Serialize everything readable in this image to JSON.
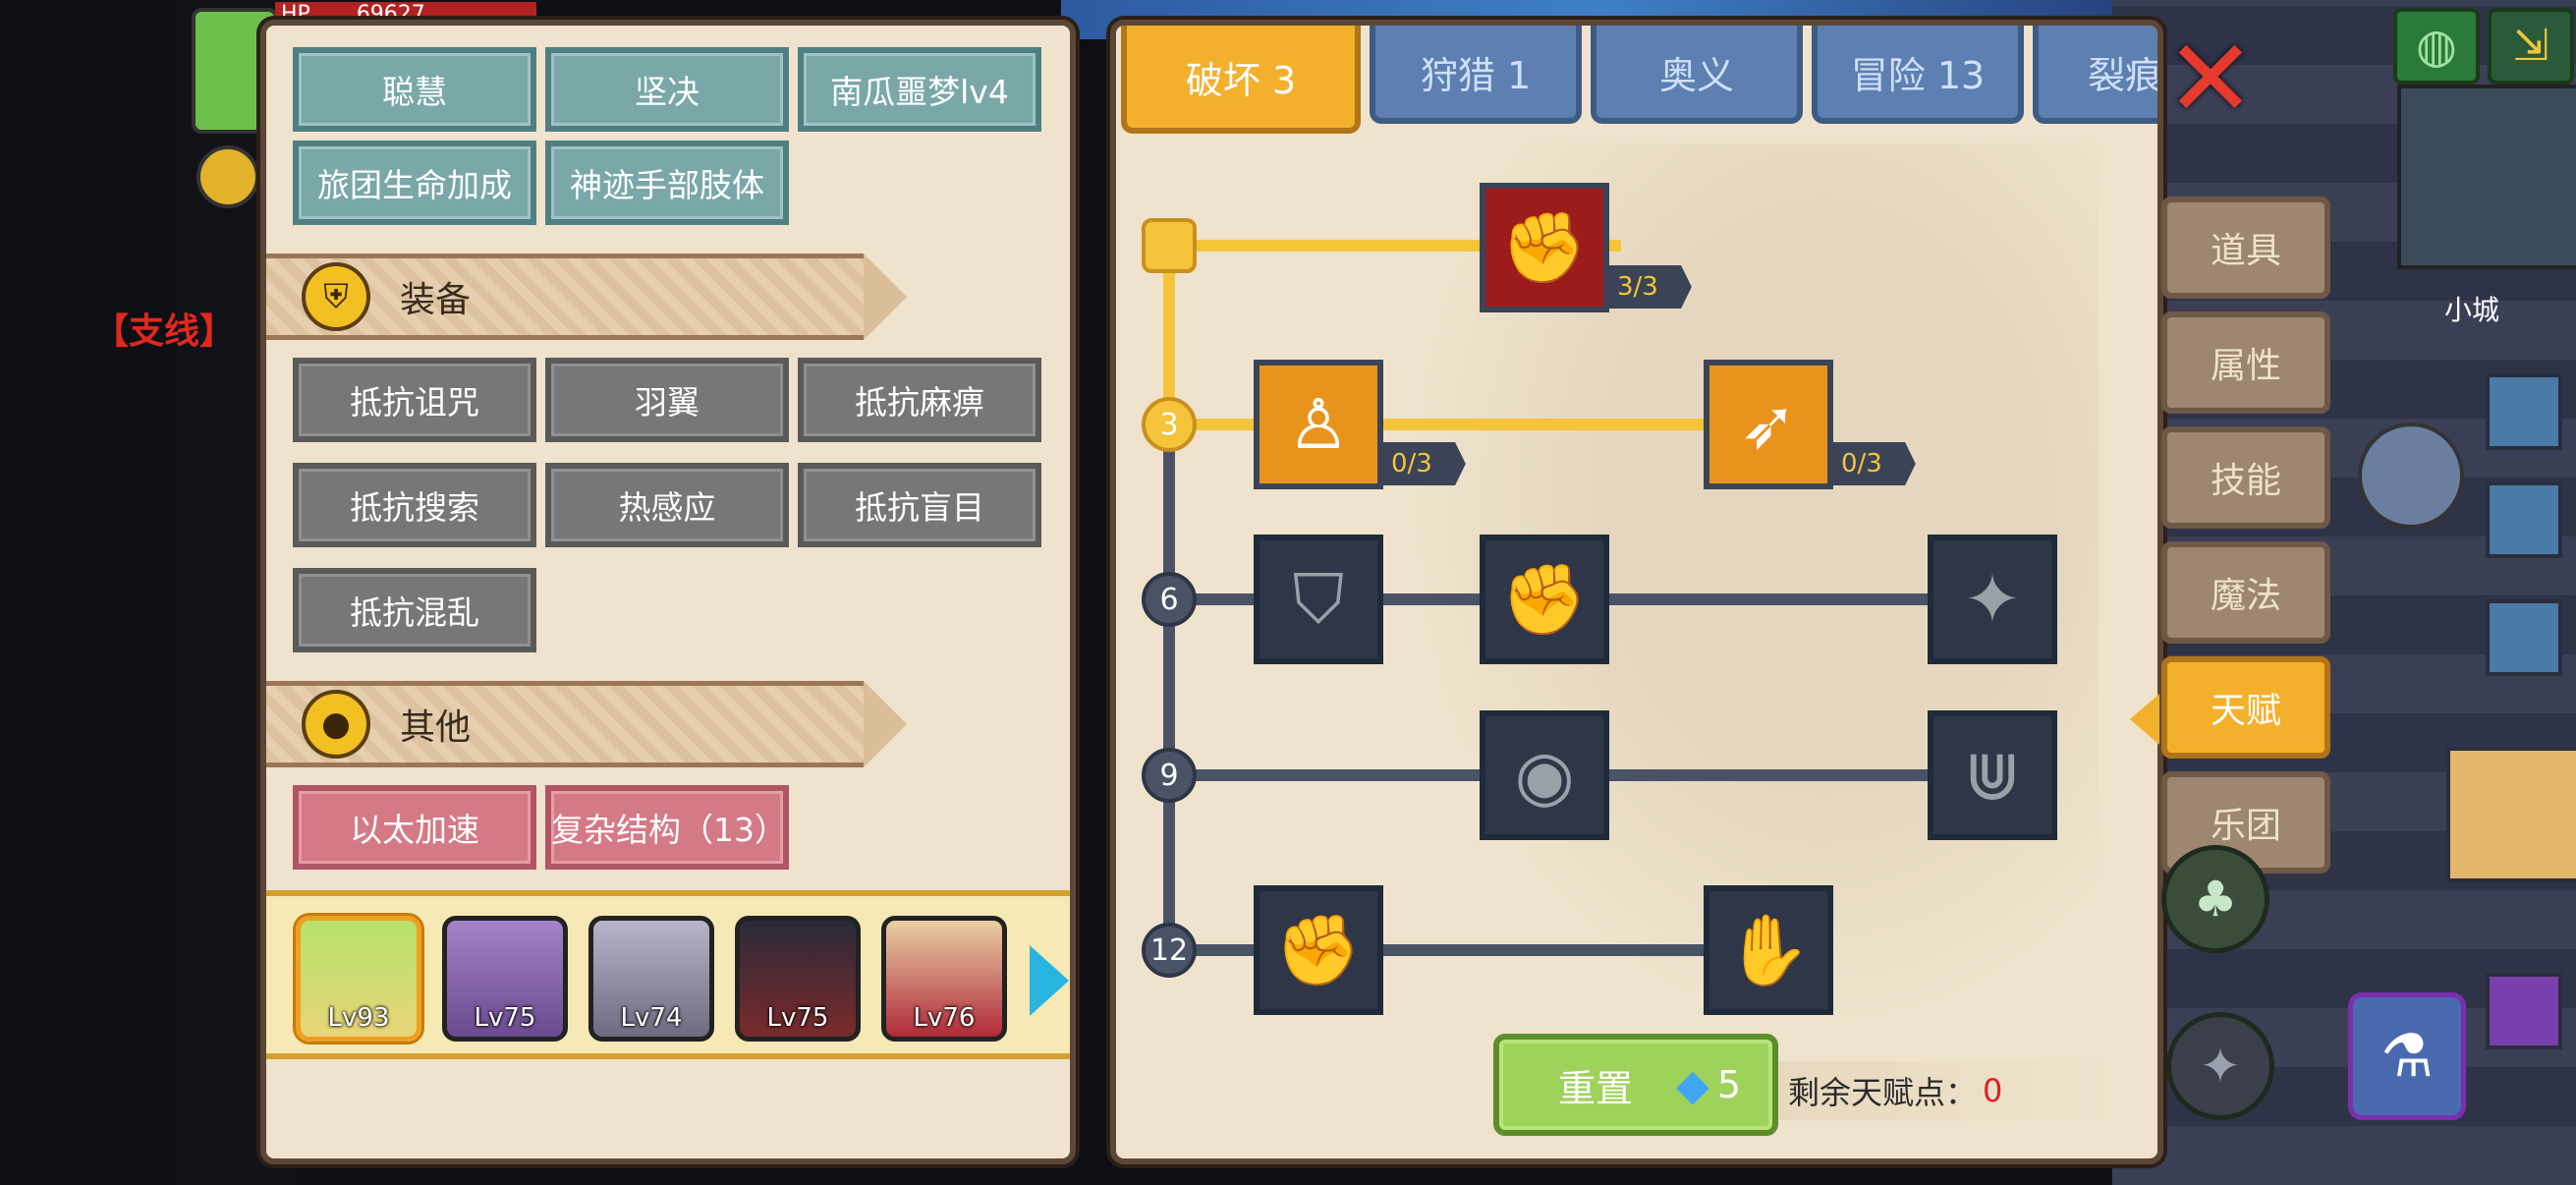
{
  "colors": {
    "panel_bg": "#efe3cd",
    "accent_gold": "#f4c43a",
    "tab_blue": "#5d7fb1",
    "red_x": "#e53a2e"
  },
  "world": {
    "side_quest": "【支线】",
    "town_label": "小城"
  },
  "hud": {
    "hp_label": "HP",
    "hp_value": "69627"
  },
  "left_panel": {
    "attr_tags": [
      "聪慧",
      "坚决",
      "南瓜噩梦lv4",
      "旅团生命加成",
      "神迹手部肢体"
    ],
    "equip_section": {
      "icon": "armor-icon",
      "title": "装备"
    },
    "equip_tags": [
      "抵抗诅咒",
      "羽翼",
      "抵抗麻痹",
      "抵抗搜索",
      "热感应",
      "抵抗盲目",
      "抵抗混乱"
    ],
    "other_section": {
      "icon": "coin-icon",
      "title": "其他"
    },
    "other_tags": [
      "以太加速",
      "复杂结构（13）"
    ],
    "heroes": [
      {
        "lv": "Lv93"
      },
      {
        "lv": "Lv75"
      },
      {
        "lv": "Lv74"
      },
      {
        "lv": "Lv75"
      },
      {
        "lv": "Lv76"
      }
    ]
  },
  "talent": {
    "tabs": [
      "破坏 3",
      "狩猎 1",
      "奥义",
      "冒险 13",
      "裂痕"
    ],
    "active_tab": 0,
    "levels": [
      "3",
      "6",
      "9",
      "12"
    ],
    "nodes": [
      {
        "icon": "arm-wrestle-icon",
        "count": "3/3"
      },
      {
        "icon": "muscle-body-icon",
        "count": "0/3"
      },
      {
        "icon": "arrow-hit-icon",
        "count": "0/3"
      }
    ],
    "reset": {
      "label": "重置",
      "gem_count": "5"
    },
    "remaining_label": "剩余天赋点：",
    "remaining_value": "0"
  },
  "right_menu": [
    "道具",
    "属性",
    "技能",
    "魔法",
    "天赋",
    "乐团"
  ],
  "right_menu_active": 4
}
